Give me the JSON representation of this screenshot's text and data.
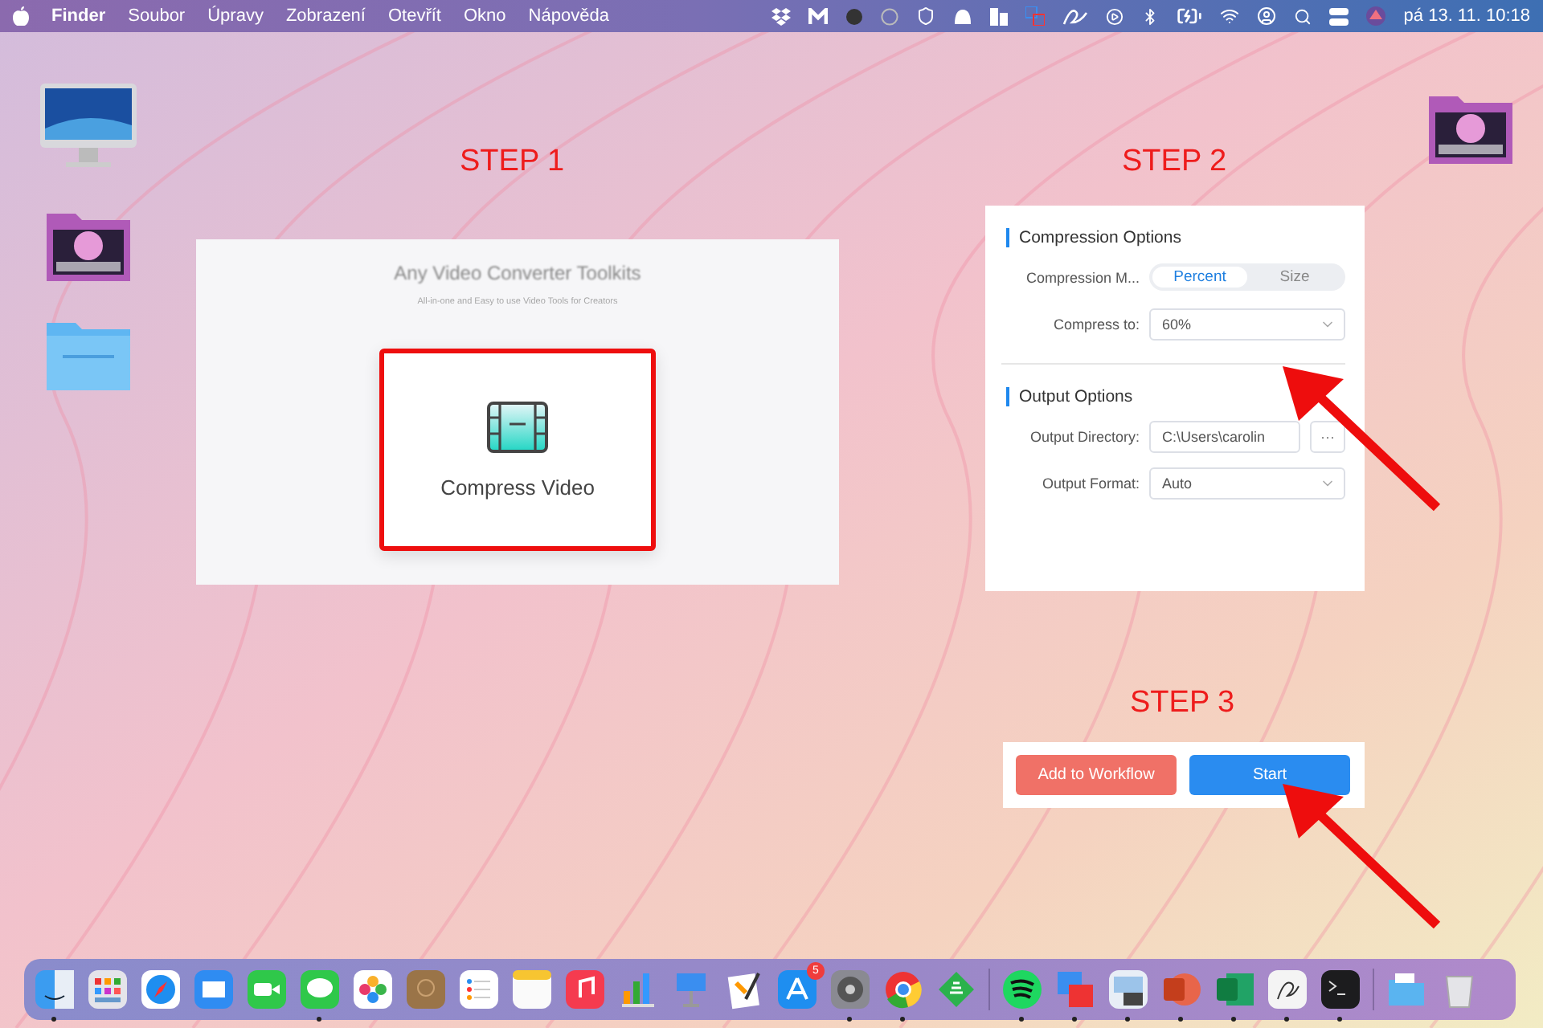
{
  "menu_bar": {
    "app_name": "Finder",
    "menus": [
      "Soubor",
      "Úpravy",
      "Zobrazení",
      "Otevřít",
      "Okno",
      "Nápověda"
    ],
    "clock": "pá 13. 11. 10:18"
  },
  "steps": [
    {
      "label": "STEP 1"
    },
    {
      "label": "STEP 2"
    },
    {
      "label": "STEP 3"
    }
  ],
  "toolkit": {
    "title": "Any Video Converter Toolkits",
    "subtitle": "All-in-one and Easy to use Video Tools for Creators",
    "tool": {
      "label": "Compress Video",
      "highlighted": true
    }
  },
  "settings": {
    "sections": [
      {
        "title": "Compression Options",
        "rows": [
          {
            "kind": "segmented",
            "label": "Compression M...",
            "options": [
              {
                "label": "Percent",
                "selected": true
              },
              {
                "label": "Size",
                "selected": false
              }
            ]
          },
          {
            "kind": "select",
            "label": "Compress to:",
            "value": "60%"
          }
        ]
      },
      {
        "title": "Output Options",
        "rows": [
          {
            "kind": "path",
            "label": "Output Directory:",
            "value": "C:\\Users\\carolin",
            "button": "···"
          },
          {
            "kind": "select",
            "label": "Output Format:",
            "value": "Auto"
          }
        ]
      }
    ]
  },
  "actions": [
    {
      "kind": "secondary",
      "label": "Add to Workflow"
    },
    {
      "kind": "primary",
      "label": "Start"
    }
  ],
  "dock": [
    {
      "kind": "app",
      "running": true
    },
    {
      "kind": "app",
      "running": false
    },
    {
      "kind": "app",
      "running": false
    },
    {
      "kind": "app",
      "running": false
    },
    {
      "kind": "app",
      "running": false
    },
    {
      "kind": "app",
      "running": true
    },
    {
      "kind": "app",
      "running": false
    },
    {
      "kind": "app",
      "running": false
    },
    {
      "kind": "app",
      "running": false
    },
    {
      "kind": "app",
      "running": false
    },
    {
      "kind": "app",
      "running": false
    },
    {
      "kind": "app",
      "running": false
    },
    {
      "kind": "app",
      "running": false
    },
    {
      "kind": "app",
      "running": false
    },
    {
      "kind": "app",
      "running": false,
      "badge": "5"
    },
    {
      "kind": "app",
      "running": true
    },
    {
      "kind": "app",
      "running": true
    },
    {
      "kind": "app",
      "running": false
    },
    {
      "kind": "divider"
    },
    {
      "kind": "app",
      "running": true
    },
    {
      "kind": "app",
      "running": true
    },
    {
      "kind": "app",
      "running": true
    },
    {
      "kind": "app",
      "running": true
    },
    {
      "kind": "app",
      "running": true
    },
    {
      "kind": "app",
      "running": true
    },
    {
      "kind": "app",
      "running": true
    },
    {
      "kind": "divider"
    },
    {
      "kind": "app",
      "running": false
    },
    {
      "kind": "app",
      "running": false
    }
  ]
}
